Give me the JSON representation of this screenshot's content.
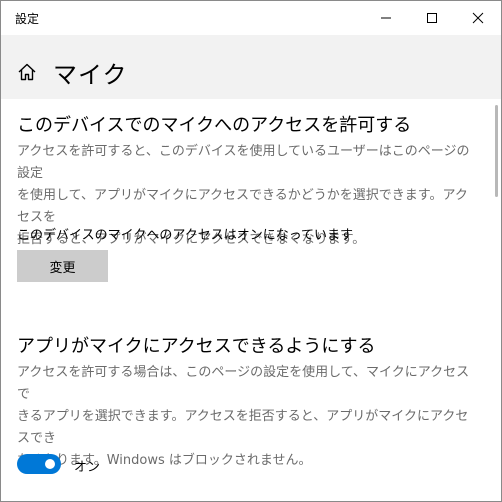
{
  "window": {
    "title": "設定"
  },
  "header": {
    "title": "マイク"
  },
  "device_access": {
    "heading": "このデバイスでのマイクへのアクセスを許可する",
    "description_lines": [
      "アクセスを許可すると、このデバイスを使用しているユーザーはこのページの設定",
      "を使用して、アプリがマイクにアクセスできるかどうかを選択できます。アクセスを",
      "拒否すると、アプリがマイクにアクセスできなくなります。"
    ],
    "status": "このデバイスのマイクへのアクセスはオンになっています",
    "change_button": "変更"
  },
  "app_access": {
    "heading": "アプリがマイクにアクセスできるようにする",
    "description_lines": [
      "アクセスを許可する場合は、このページの設定を使用して、マイクにアクセスで",
      "きるアプリを選択できます。アクセスを拒否すると、アプリがマイクにアクセスでき",
      "なくなります。Windows はブロックされません。"
    ],
    "toggle_state": "オン",
    "toggle_on": true
  },
  "colors": {
    "accent": "#0078d7",
    "header_bg": "#f2f2f2",
    "description_text": "#6b6b6b",
    "button_bg": "#cccccc"
  },
  "icons": {
    "home": "home-icon",
    "minimize": "minimize-icon",
    "maximize": "maximize-icon",
    "close": "close-icon"
  }
}
